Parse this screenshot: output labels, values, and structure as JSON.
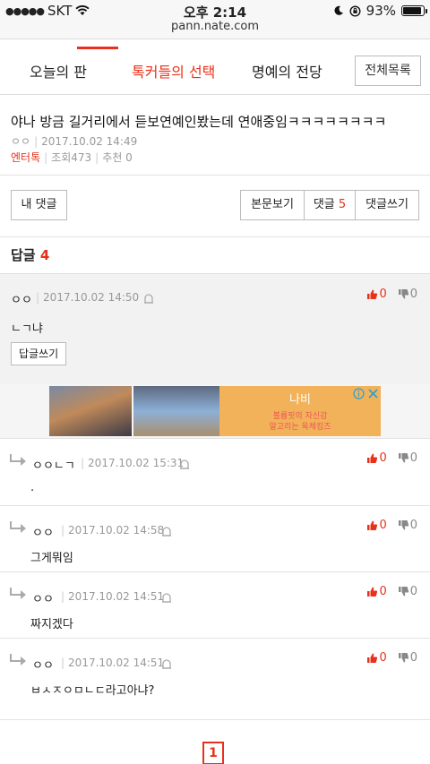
{
  "status_bar": {
    "carrier": "SKT",
    "time": "오후 2:14",
    "battery": "93%",
    "battery_level": 0.93
  },
  "url": "pann.nate.com",
  "nav": {
    "tabs": [
      "오늘의 판",
      "톡커들의 선택",
      "명예의 전당"
    ],
    "active_index": 1,
    "full_list": "전체목록"
  },
  "post": {
    "title": "야나 방금 길거리에서 듣보연예인봤는데 연애중임ㅋㅋㅋㅋㅋㅋㅋㅋ",
    "author": "ㅇㅇ",
    "date": "2017.10.02 14:49",
    "category": "엔터톡",
    "views": "조회473",
    "recommend": "추천 0"
  },
  "buttons": {
    "my_comments": "내 댓글",
    "view_body": "본문보기",
    "comments": "댓글",
    "comments_count": "5",
    "write_comment": "댓글쓰기"
  },
  "replies_heading": {
    "label": "답글",
    "count": "4"
  },
  "main_comment": {
    "author": "ㅇㅇ",
    "date": "2017.10.02 14:50",
    "text": "ㄴㄱ냐",
    "up": "0",
    "down": "0",
    "reply_button": "답글쓰기"
  },
  "ad": {
    "logo": "나비",
    "line1": "볼륨핏의 자신감",
    "line2": "알고리는 육체킹즈"
  },
  "sub_comments": [
    {
      "author": "ㅇㅇㄴㄱ",
      "date": "2017.10.02 15:31",
      "text": ".",
      "up": "0",
      "down": "0"
    },
    {
      "author": "ㅇㅇ",
      "date": "2017.10.02 14:58",
      "text": "그게뭐임",
      "up": "0",
      "down": "0"
    },
    {
      "author": "ㅇㅇ",
      "date": "2017.10.02 14:51",
      "text": "짜지겠다",
      "up": "0",
      "down": "0"
    },
    {
      "author": "ㅇㅇ",
      "date": "2017.10.02 14:51",
      "text": "ㅂㅅㅈㅇㅁㄴㄷ라고아냐?",
      "up": "0",
      "down": "0"
    }
  ],
  "pager": {
    "current": "1"
  },
  "colors": {
    "accent": "#e8311a",
    "muted": "#999999"
  }
}
